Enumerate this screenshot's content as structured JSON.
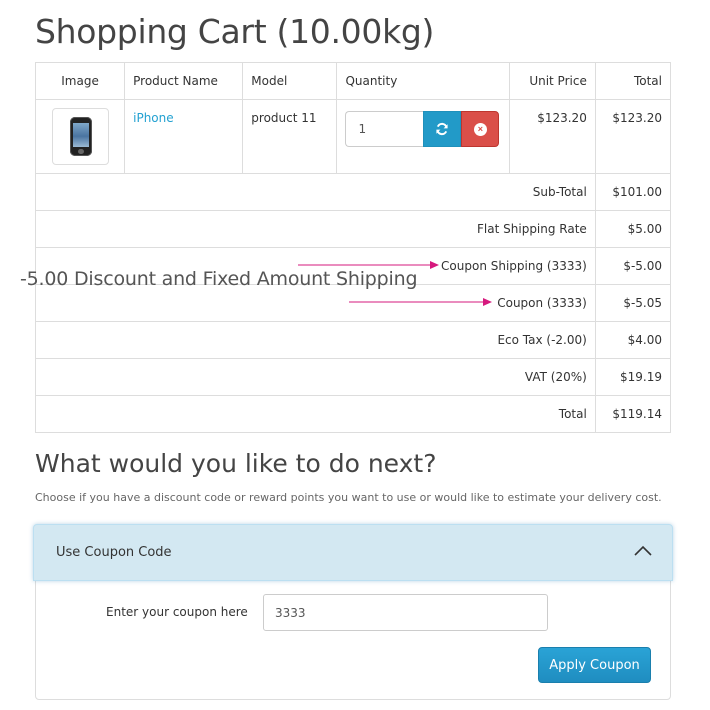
{
  "page": {
    "title": "Shopping Cart (10.00kg)"
  },
  "cart": {
    "columns": [
      "Image",
      "Product Name",
      "Model",
      "Quantity",
      "Unit Price",
      "Total"
    ],
    "items": [
      {
        "image_icon": "iphone-thumbnail",
        "name": "iPhone",
        "model": "product 11",
        "quantity": "1",
        "unit_price": "$123.20",
        "total": "$123.20"
      }
    ],
    "update_icon": "refresh-icon",
    "remove_icon": "remove-icon",
    "summary": [
      {
        "label": "Sub-Total",
        "value": "$101.00"
      },
      {
        "label": "Flat Shipping Rate",
        "value": "$5.00"
      },
      {
        "label": "Coupon Shipping (3333)",
        "value": "$-5.00"
      },
      {
        "label": "Coupon (3333)",
        "value": "$-5.05"
      },
      {
        "label": "Eco Tax (-2.00)",
        "value": "$4.00"
      },
      {
        "label": "VAT (20%)",
        "value": "$19.19"
      },
      {
        "label": "Total",
        "value": "$119.14"
      }
    ]
  },
  "annotation": {
    "text": "-5.00 Discount and Fixed Amount Shipping",
    "arrow_color": "#d6197d"
  },
  "next": {
    "title": "What would you like to do next?",
    "description": "Choose if you have a discount code or reward points you want to use or would like to estimate your delivery cost."
  },
  "coupon_panel": {
    "heading": "Use Coupon Code",
    "toggle_icon": "chevron-up-icon",
    "field_label": "Enter your coupon here",
    "field_value": "3333",
    "button_label": "Apply Coupon"
  },
  "colors": {
    "link": "#23a1d1",
    "primary_button": "#229ac8",
    "danger_button": "#da4f49",
    "panel_heading_bg": "#d3e8f2"
  }
}
